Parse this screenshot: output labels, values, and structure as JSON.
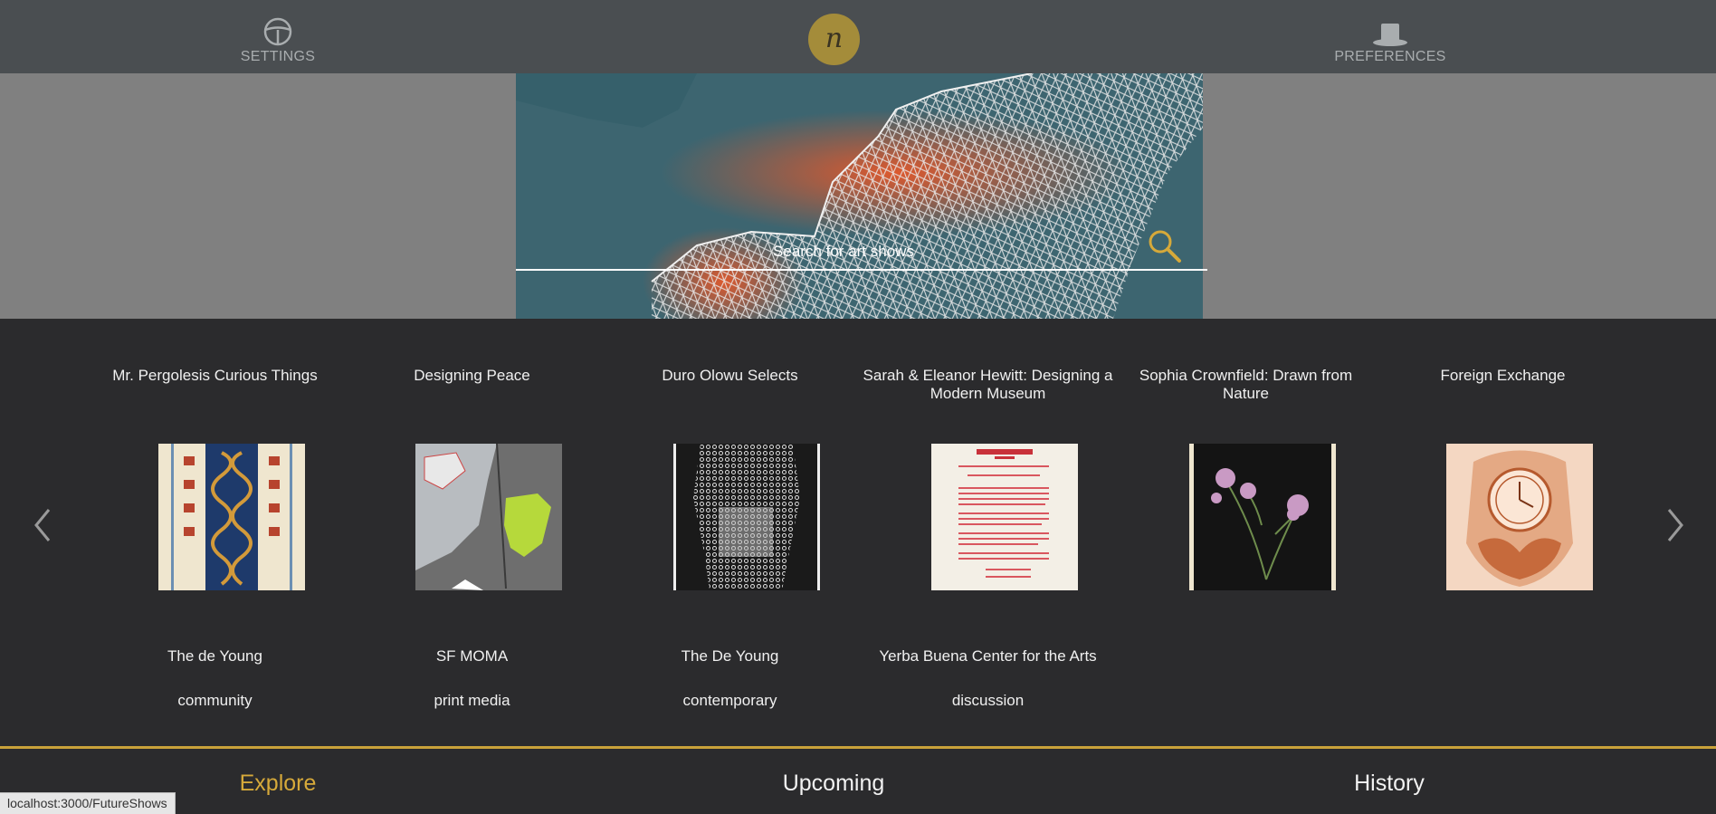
{
  "topnav": {
    "settings_label": "SETTINGS",
    "preferences_label": "PREFERENCES",
    "logo_letter": "n"
  },
  "search": {
    "placeholder": "Search for art shows"
  },
  "colors": {
    "accent": "#d6a93a",
    "nav_bg": "#4a4e51",
    "body_bg": "#2b2b2d"
  },
  "shows": [
    {
      "title": "Mr. Pergolesis Curious Things",
      "venue": "The de Young",
      "tag": "community",
      "thumb": "ornament-panels"
    },
    {
      "title": "Designing Peace",
      "venue": "SF MOMA",
      "tag": "print media",
      "thumb": "map-green"
    },
    {
      "title": "Duro Olowu Selects",
      "venue": "The De Young",
      "tag": "contemporary",
      "thumb": "lace-drawing"
    },
    {
      "title": "Sarah & Eleanor Hewitt: Designing a Modern Museum",
      "venue": "Yerba Buena Center for the Arts",
      "tag": "discussion",
      "thumb": "red-text-document"
    },
    {
      "title": "Sophia Crownfield: Drawn from Nature",
      "venue": "",
      "tag": "",
      "thumb": "thistle-flowers"
    },
    {
      "title": "Foreign Exchange",
      "venue": "",
      "tag": "",
      "thumb": "ornate-clock"
    }
  ],
  "footer": {
    "tabs": [
      "Explore",
      "Upcoming",
      "History"
    ],
    "active": "Explore"
  },
  "statusbar": {
    "url": "localhost:3000/FutureShows"
  }
}
